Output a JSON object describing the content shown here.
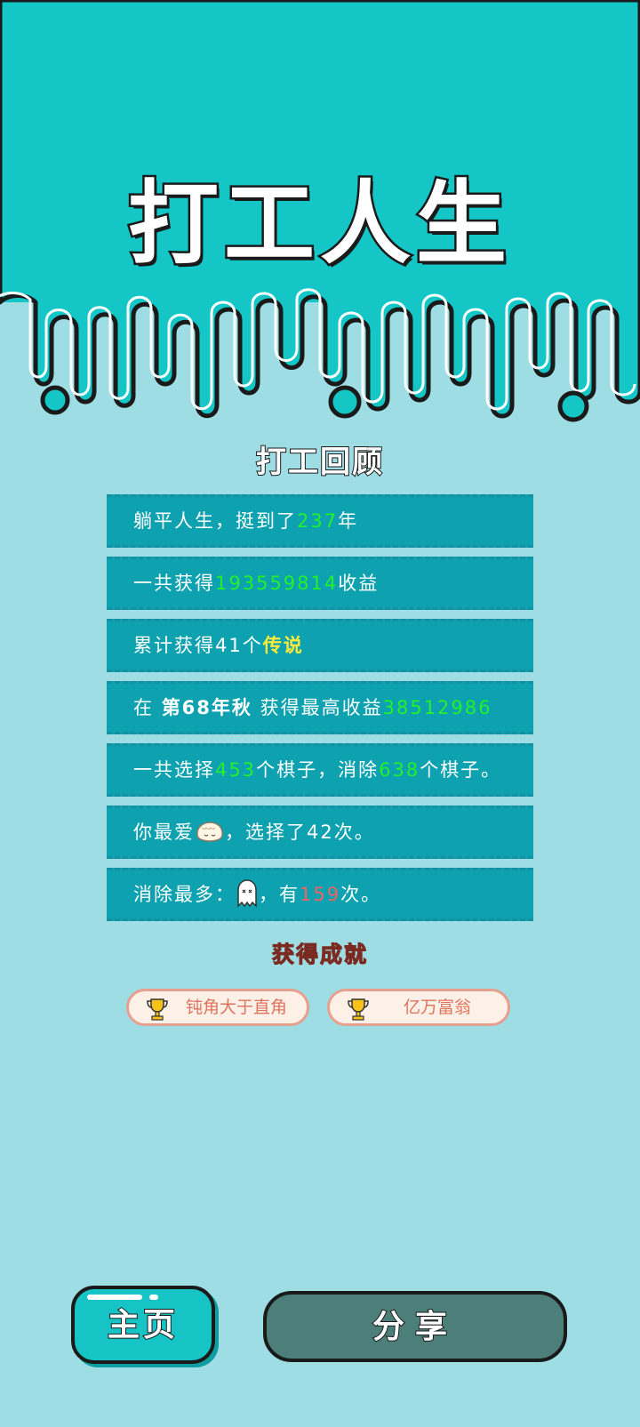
{
  "app": {
    "title": "打工人生"
  },
  "review": {
    "title": "打工回顾"
  },
  "stats": [
    {
      "pre": "躺平人生，挺到了",
      "hl": "237",
      "post": "年"
    },
    {
      "pre": "一共获得",
      "hl": "193559814",
      "post": "收益"
    },
    {
      "pre": "累计获得41个",
      "hl": "传说",
      "post": ""
    },
    {
      "pre": "在 ",
      "bold": "第68年秋",
      "mid": " 获得最高收益",
      "hl": "38512986"
    },
    {
      "pre": "一共选择",
      "hl": "453",
      "mid": "个棋子，消除",
      "hl2": "638",
      "post": "个棋子。"
    },
    {
      "pre": "你最爱",
      "icon": "dumpling-icon",
      "post": "，选择了42次。"
    },
    {
      "pre": "消除最多：",
      "icon": "ghost-icon",
      "mid": "，有",
      "hl": "159",
      "post": "次。"
    }
  ],
  "achievements": {
    "title": "获得成就",
    "items": [
      {
        "label": "钝角大于直角",
        "icon": "trophy-icon"
      },
      {
        "label": "亿万富翁",
        "icon": "trophy-icon"
      }
    ]
  },
  "buttons": {
    "home": "主页",
    "share": "分享"
  },
  "colors": {
    "header": "#15c6c7",
    "background": "#9fdde4",
    "row": "#0ea2b0",
    "highlight": "#22f02a",
    "legend": "#ffea3a"
  }
}
